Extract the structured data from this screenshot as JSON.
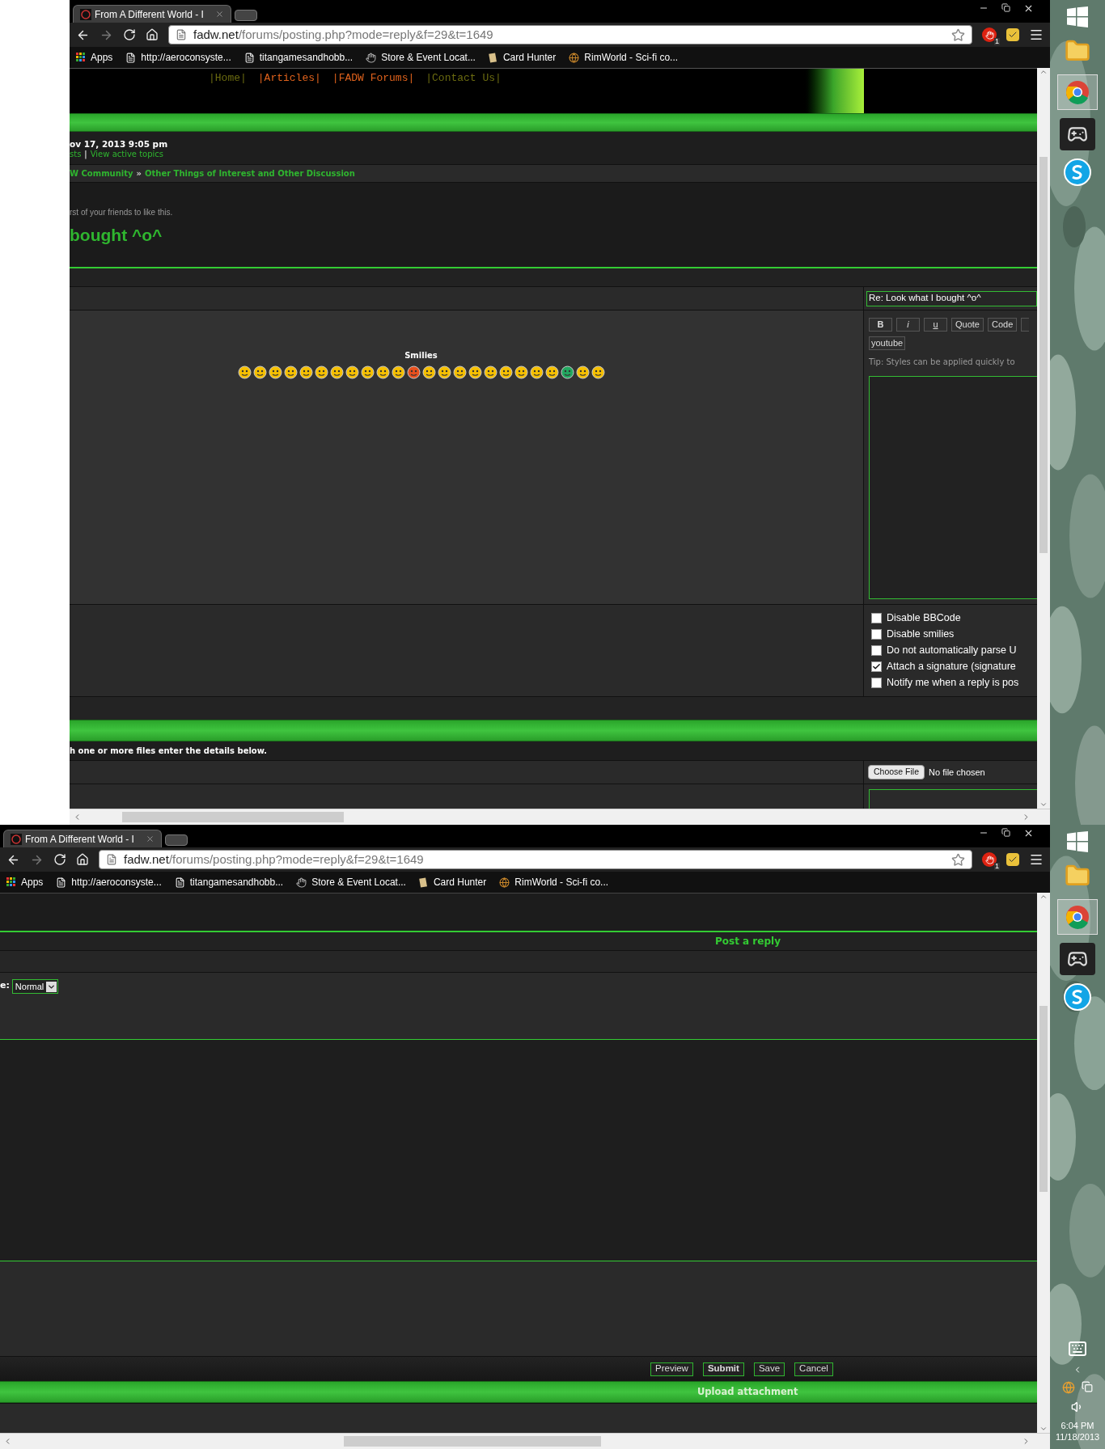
{
  "top_window": {
    "browser": {
      "tab_title": "From A Different World - I",
      "url": {
        "host": "fadw.net",
        "path": "/forums/posting.php?mode=reply&f=29&t=1649"
      },
      "extension_badge": "1",
      "bookmarks": [
        {
          "kind": "apps",
          "label": "Apps"
        },
        {
          "kind": "page",
          "label": "http://aeroconsyste..."
        },
        {
          "kind": "page",
          "label": "titangamesandhobb..."
        },
        {
          "kind": "store",
          "label": "Store & Event Locat..."
        },
        {
          "kind": "card",
          "label": "Card Hunter"
        },
        {
          "kind": "globe",
          "label": "RimWorld - Sci-fi co..."
        }
      ]
    },
    "page": {
      "nav": [
        {
          "label": "|Home|",
          "color": "#6b6b10"
        },
        {
          "label": "|Articles|",
          "color": "#e0621c"
        },
        {
          "label": "|FADW Forums|",
          "color": "#e0621c"
        },
        {
          "label": "|Contact Us|",
          "color": "#6b6b10"
        }
      ],
      "date": "ov 17, 2013 9:05 pm",
      "links": [
        "sts",
        "|",
        "View active topics"
      ],
      "breadcrumb": [
        "W Community",
        "»",
        "Other Things of Interest and Other Discussion"
      ],
      "friends_text": "rst of your friends to like this.",
      "topic_title": "bought ^o^",
      "subject": "Re: Look what I bought ^o^",
      "smilies_title": "Smilies",
      "format_buttons": [
        {
          "kind": "bold",
          "label": "B"
        },
        {
          "kind": "italic",
          "label": "i"
        },
        {
          "kind": "underline",
          "label": "u"
        },
        {
          "kind": "plain",
          "label": "Quote"
        },
        {
          "kind": "plain",
          "label": "Code"
        }
      ],
      "youtube_button": "youtube",
      "tip": "Tip: Styles can be applied quickly to",
      "options": [
        {
          "label": "Disable BBCode",
          "checked": false
        },
        {
          "label": "Disable smilies",
          "checked": false
        },
        {
          "label": "Do not automatically parse U",
          "checked": false
        },
        {
          "label": "Attach a signature (signature",
          "checked": true
        },
        {
          "label": "Notify me when a reply is pos",
          "checked": false
        }
      ],
      "attachment_hint": "h one or more files enter the details below.",
      "file_button": "Choose File",
      "file_status": "No file chosen"
    }
  },
  "bottom_window": {
    "browser": {
      "tab_title": "From A Different World - I",
      "url": {
        "host": "fadw.net",
        "path": "/forums/posting.php?mode=reply&f=29&t=1649"
      },
      "extension_badge": "1",
      "bookmarks": [
        {
          "kind": "apps",
          "label": "Apps"
        },
        {
          "kind": "page",
          "label": "http://aeroconsyste..."
        },
        {
          "kind": "page",
          "label": "titangamesandhobb..."
        },
        {
          "kind": "store",
          "label": "Store & Event Locat..."
        },
        {
          "kind": "card",
          "label": "Card Hunter"
        },
        {
          "kind": "globe",
          "label": "RimWorld - Sci-fi co..."
        }
      ]
    },
    "page": {
      "post_reply_title": "Post a reply",
      "select_label": "e:",
      "select_value": "Normal",
      "actions": [
        {
          "label": "Preview",
          "primary": false
        },
        {
          "label": "Submit",
          "primary": true
        },
        {
          "label": "Save",
          "primary": false
        },
        {
          "label": "Cancel",
          "primary": false
        }
      ],
      "upload_title": "Upload attachment"
    }
  },
  "taskbar": {
    "time": "6:04 PM",
    "date": "11/18/2013"
  }
}
